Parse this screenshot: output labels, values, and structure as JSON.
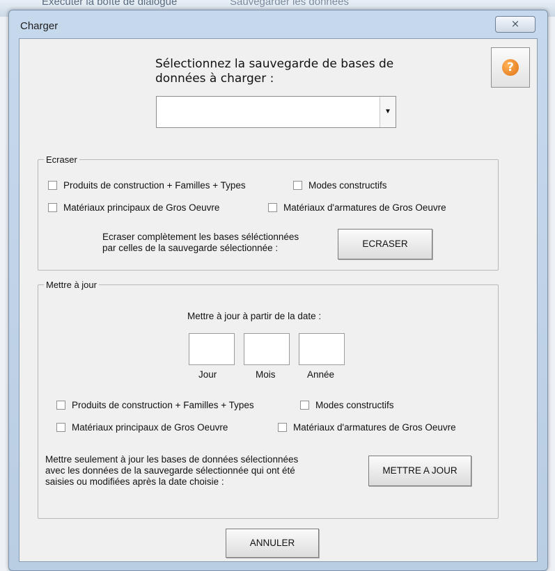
{
  "background": {
    "text_left": "Exécuter la boîte de dialogue",
    "text_right": "Sauvegarder les données"
  },
  "window": {
    "title": "Charger",
    "close_label": "⨯"
  },
  "header": {
    "prompt": "Sélectionnez la sauvegarde de bases de données à charger :",
    "combo_value": "",
    "combo_arrow": "▼",
    "help_glyph": "?"
  },
  "overwrite": {
    "legend": "Ecraser",
    "checkboxes": [
      "Produits de construction + Familles + Types",
      "Modes constructifs",
      "Matériaux principaux de Gros Oeuvre",
      "Matériaux d'armatures de Gros Oeuvre"
    ],
    "description": "Ecraser complètement les bases séléctionnées\npar celles de la sauvegarde sélectionnée :",
    "button": "ECRASER"
  },
  "update": {
    "legend": "Mettre à jour",
    "date_caption": "Mettre à jour à partir de la date :",
    "date_labels": [
      "Jour",
      "Mois",
      "Année"
    ],
    "checkboxes": [
      "Produits de construction + Familles + Types",
      "Modes constructifs",
      "Matériaux principaux de Gros Oeuvre",
      "Matériaux d'armatures de Gros Oeuvre"
    ],
    "description": "Mettre seulement à jour les bases de données sélectionnées\navec les données de la sauvegarde sélectionnée qui ont été\nsaisies ou modifiées après la date choisie :",
    "button": "METTRE A JOUR"
  },
  "footer": {
    "cancel": "ANNULER"
  }
}
